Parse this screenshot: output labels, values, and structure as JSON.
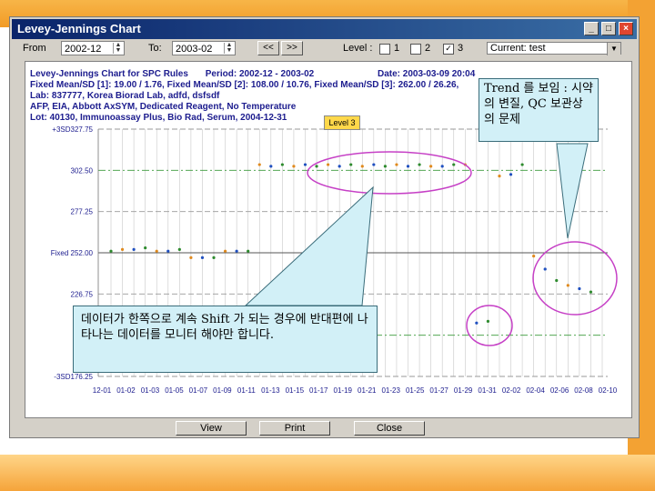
{
  "window": {
    "title": "Levey-Jennings Chart",
    "min_icon": "minimize-icon",
    "max_icon": "maximize-icon",
    "close_icon": "close-icon"
  },
  "toolbar": {
    "from_label": "From",
    "from_value": "2002-12",
    "to_label": "To:",
    "to_value": "2003-02",
    "prev_label": "<<",
    "next_label": ">>",
    "level_label": "Level :",
    "levels": [
      {
        "label": "1",
        "checked": false
      },
      {
        "label": "2",
        "checked": false
      },
      {
        "label": "3",
        "checked": true
      }
    ],
    "current_value": "Current: test"
  },
  "chart_header": {
    "line1_left": "Levey-Jennings Chart for SPC Rules",
    "line1_mid": "Period: 2002-12 - 2003-02",
    "line1_right": "Date: 2003-03-09 20:04",
    "line2": "Fixed Mean/SD [1]: 19.00 / 1.76, Fixed Mean/SD [2]: 108.00 / 10.76, Fixed Mean/SD [3]: 262.00 / 26.26,",
    "line3": "Lab: 837777, Korea Biorad Lab, adfd, dsfsdf",
    "line4": "AFP, EIA, Abbott AxSYM, Dedicated Reagent, No Temperature",
    "line5": "Lot: 40130, Immunoassay Plus, Bio Rad, Serum, 2004-12-31"
  },
  "level_badge": "Level 3",
  "chart_data": {
    "type": "scatter",
    "title": "Levey-Jennings Chart for SPC Rules",
    "y_tick_labels": [
      "+3SD327.75",
      "302.50",
      "277.25",
      "Fixed 252.00",
      "226.75",
      "",
      "-3SD176.25"
    ],
    "y_ticks": [
      327.75,
      302.5,
      277.25,
      252.0,
      226.75,
      201.5,
      176.25
    ],
    "ylim": [
      176.25,
      327.75
    ],
    "x_tick_labels": [
      "12-01",
      "01-02",
      "01-03",
      "01-05",
      "01-07",
      "01-09",
      "01-11",
      "01-13",
      "01-15",
      "01-17",
      "01-19",
      "01-21",
      "01-23",
      "01-25",
      "01-27",
      "01-29",
      "01-31",
      "02-02",
      "02-04",
      "02-06",
      "02-08",
      "02-10"
    ],
    "points": [
      {
        "x": 1,
        "y": 253
      },
      {
        "x": 2,
        "y": 254
      },
      {
        "x": 3,
        "y": 254
      },
      {
        "x": 4,
        "y": 255
      },
      {
        "x": 5,
        "y": 253
      },
      {
        "x": 6,
        "y": 253
      },
      {
        "x": 7,
        "y": 254
      },
      {
        "x": 8,
        "y": 249
      },
      {
        "x": 9,
        "y": 249
      },
      {
        "x": 10,
        "y": 249
      },
      {
        "x": 11,
        "y": 253
      },
      {
        "x": 12,
        "y": 253
      },
      {
        "x": 13,
        "y": 253
      },
      {
        "x": 14,
        "y": 306
      },
      {
        "x": 15,
        "y": 305
      },
      {
        "x": 16,
        "y": 306
      },
      {
        "x": 17,
        "y": 305
      },
      {
        "x": 18,
        "y": 306
      },
      {
        "x": 19,
        "y": 305
      },
      {
        "x": 20,
        "y": 306
      },
      {
        "x": 21,
        "y": 305
      },
      {
        "x": 22,
        "y": 306
      },
      {
        "x": 23,
        "y": 305
      },
      {
        "x": 24,
        "y": 306
      },
      {
        "x": 25,
        "y": 305
      },
      {
        "x": 26,
        "y": 306
      },
      {
        "x": 27,
        "y": 305
      },
      {
        "x": 28,
        "y": 306
      },
      {
        "x": 29,
        "y": 305
      },
      {
        "x": 30,
        "y": 305
      },
      {
        "x": 31,
        "y": 306
      },
      {
        "x": 32,
        "y": 306
      },
      {
        "x": 33,
        "y": 209
      },
      {
        "x": 34,
        "y": 210
      },
      {
        "x": 35,
        "y": 299
      },
      {
        "x": 36,
        "y": 300
      },
      {
        "x": 37,
        "y": 306
      },
      {
        "x": 38,
        "y": 250
      },
      {
        "x": 39,
        "y": 242
      },
      {
        "x": 40,
        "y": 235
      },
      {
        "x": 41,
        "y": 232
      },
      {
        "x": 42,
        "y": 230
      },
      {
        "x": 43,
        "y": 228
      }
    ],
    "point_colors": [
      "#2e8b2e",
      "#e08a1e",
      "#2050c0"
    ]
  },
  "buttons": {
    "view": "View",
    "print": "Print",
    "close": "Close"
  },
  "callout_shift": "데이터가 한쪽으로 계속 Shift 가 되는 경우에 반대편에 나타나는 데이터를 모니터 해야만 합니다.",
  "callout_trend": "Trend 를 보임 : 시약의 변질, QC 보관상의 문제",
  "colors": {
    "highlight_ellipse": "#c640c6",
    "callout_fill": "#d2f0f7",
    "accent_orange": "#f29b26"
  }
}
